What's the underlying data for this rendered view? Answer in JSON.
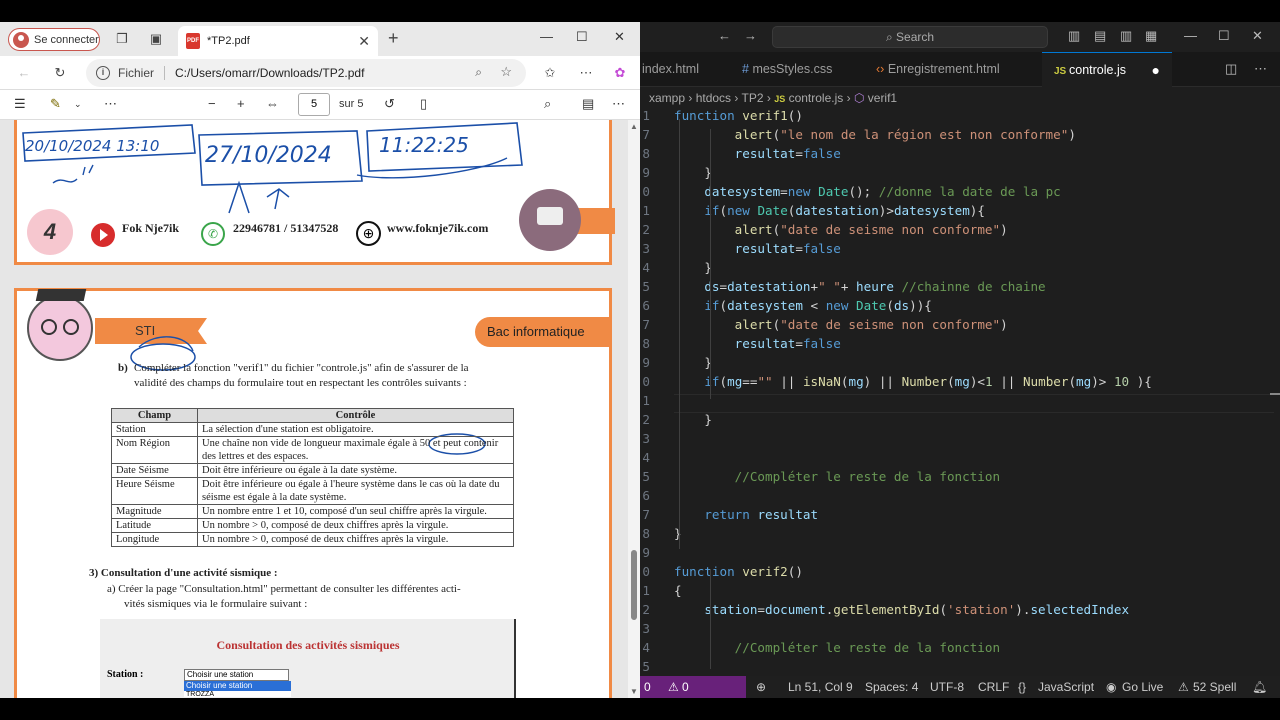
{
  "browser": {
    "profile_button": "Se connecter",
    "tab_title": "*TP2.pdf",
    "tab_icon_text": "PDF",
    "address_label": "Fichier",
    "address_url": "C:/Users/omarr/Downloads/TP2.pdf",
    "pdf_toolbar": {
      "page": "5",
      "page_total": "sur 5"
    }
  },
  "pdf": {
    "handwriting": [
      "20/10/2024 13:10",
      "27/10/2024",
      "11:22:25"
    ],
    "page_badge": "4",
    "contact": {
      "name": "Fok Nje7ik",
      "phone": "22946781 / 51347528",
      "website": "www.foknje7ik.com"
    },
    "ribbon_left": "STI",
    "ribbon_right": "Bac informatique",
    "item_b_label": "b)",
    "item_b_text_1": "Compléter la fonction \"verif1\" du fichier \"controle.js\" afin de s'assurer de la",
    "item_b_text_2": "validité des champs du formulaire tout en respectant les contrôles suivants :",
    "table": {
      "headers": [
        "Champ",
        "Contrôle"
      ],
      "rows": [
        [
          "Station",
          "La sélection d'une station est obligatoire."
        ],
        [
          "Nom Région",
          "Une chaîne non vide de longueur maximale égale à 50 et peut contenir des lettres et des espaces."
        ],
        [
          "Date Séisme",
          "Doit être inférieure ou égale à la date système."
        ],
        [
          "Heure Séisme",
          "Doit être inférieure ou égale à l'heure système dans le cas où la date du séisme est égale à la date système."
        ],
        [
          "Magnitude",
          "Un nombre entre 1 et 10, composé d'un seul chiffre après la virgule."
        ],
        [
          "Latitude",
          "Un nombre > 0, composé de deux chiffres après la virgule."
        ],
        [
          "Longitude",
          "Un nombre > 0, composé de deux chiffres après la virgule."
        ]
      ]
    },
    "section3": "3)  Consultation d'une activité sismique :",
    "item_a_1": "a)  Créer la page \"Consultation.html\" permettant de consulter les différentes acti-",
    "item_a_2": "vités sismiques via le formulaire suivant :",
    "form_title": "Consultation des activités sismiques",
    "form_station_label": "Station :",
    "form_select_value": "Choisir une station",
    "form_option_highlight": "Choisir une station",
    "form_option_next": "TROZZA"
  },
  "vscode": {
    "search_placeholder": "Search",
    "tabs": [
      "index.html",
      "mesStyles.css",
      "Enregistrement.html",
      "controle.js"
    ],
    "active_tab": "controle.js",
    "breadcrumb": [
      "xampp",
      "htdocs",
      "TP2",
      "controle.js",
      "verif1"
    ],
    "status": {
      "errors": "0",
      "warnings": "0",
      "position": "Ln 51, Col 9",
      "spaces": "Spaces: 4",
      "encoding": "UTF-8",
      "eol": "CRLF",
      "language": "JavaScript",
      "golive": "Go Live",
      "spell": "52 Spell"
    },
    "code": [
      {
        "n": "1",
        "t": "function verif1()"
      },
      {
        "n": "7",
        "t": "        alert(\"le nom de la région est non conforme\")"
      },
      {
        "n": "8",
        "t": "        resultat=false"
      },
      {
        "n": "9",
        "t": "    }"
      },
      {
        "n": "0",
        "t": "    datesystem=new Date(); //donne la date de la pc"
      },
      {
        "n": "1",
        "t": "    if(new Date(datestation)>datesystem){"
      },
      {
        "n": "2",
        "t": "        alert(\"date de seisme non conforme\")"
      },
      {
        "n": "3",
        "t": "        resultat=false"
      },
      {
        "n": "4",
        "t": "    }"
      },
      {
        "n": "5",
        "t": "    ds=datestation+\" \"+ heure //chainne de chaine"
      },
      {
        "n": "6",
        "t": "    if(datesystem < new Date(ds)){"
      },
      {
        "n": "7",
        "t": "        alert(\"date de seisme non conforme\")"
      },
      {
        "n": "8",
        "t": "        resultat=false"
      },
      {
        "n": "9",
        "t": "    }"
      },
      {
        "n": "0",
        "t": "    if(mg==\"\" || isNaN(mg) || Number(mg)<1 || Number(mg)> 10 ){"
      },
      {
        "n": "1",
        "t": ""
      },
      {
        "n": "2",
        "t": "    }"
      },
      {
        "n": "3",
        "t": ""
      },
      {
        "n": "4",
        "t": ""
      },
      {
        "n": "5",
        "t": "        //Compléter le reste de la fonction"
      },
      {
        "n": "6",
        "t": ""
      },
      {
        "n": "7",
        "t": "    return resultat"
      },
      {
        "n": "8",
        "t": "}"
      },
      {
        "n": "9",
        "t": ""
      },
      {
        "n": "0",
        "t": "function verif2()"
      },
      {
        "n": "1",
        "t": "{"
      },
      {
        "n": "2",
        "t": "    station=document.getElementById('station').selectedIndex"
      },
      {
        "n": "3",
        "t": ""
      },
      {
        "n": "4",
        "t": "        //Compléter le reste de la fonction"
      },
      {
        "n": "5",
        "t": ""
      }
    ]
  },
  "colors": {
    "accent_orange": "#f08a45",
    "vscode_remote": "#68217a",
    "vscode_bg": "#1e1e1e"
  }
}
